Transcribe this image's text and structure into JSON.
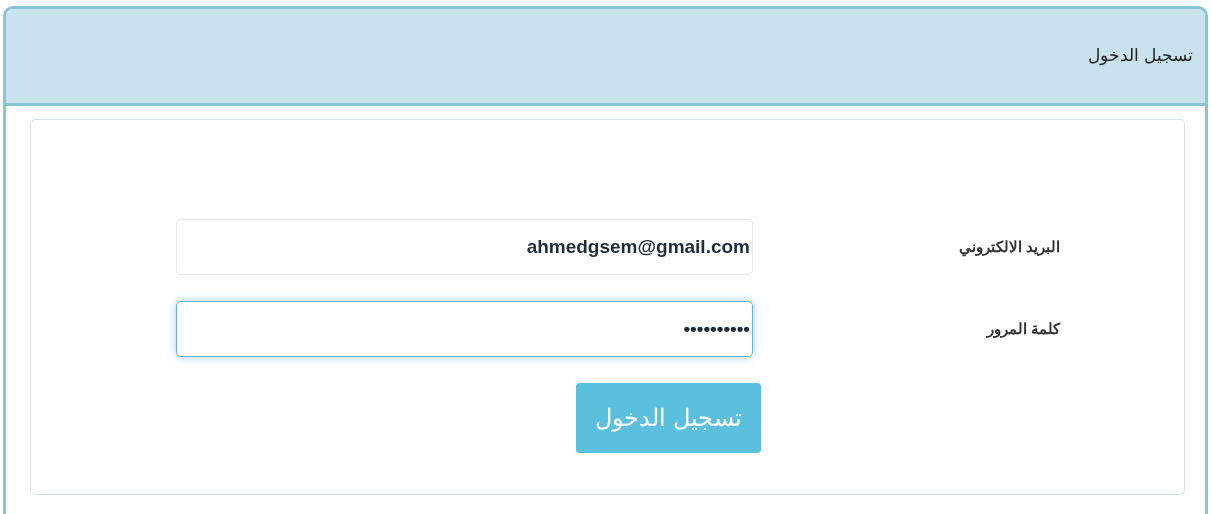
{
  "panel": {
    "title": "تسجيل الدخول"
  },
  "fields": [
    {
      "label": "البريد الالكتروني",
      "value": "ahmedgsem@gmail.com",
      "focused": false
    },
    {
      "label": "كلمة المرور",
      "value": "••••••••••",
      "focused": true
    }
  ],
  "submit_button": {
    "label": "تسجيل الدخول"
  }
}
